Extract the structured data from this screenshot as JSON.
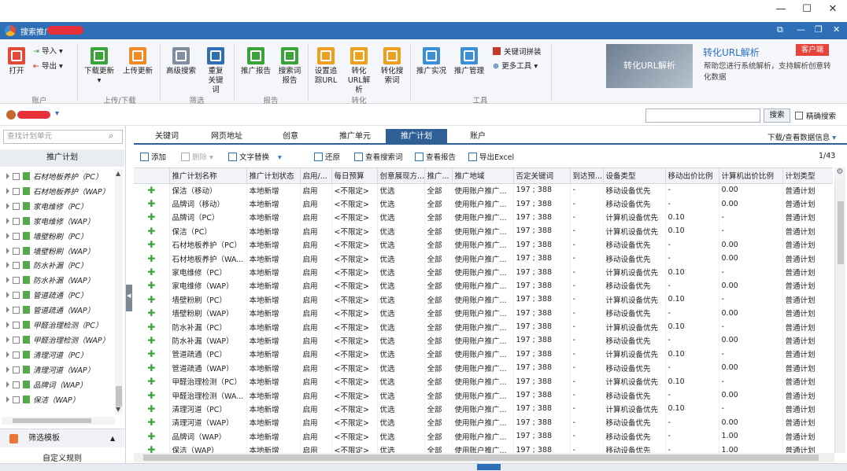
{
  "window": {
    "minimize": "—",
    "maximize": "☐",
    "close": "✕"
  },
  "app": {
    "title": "搜索推广",
    "header_icons": [
      "⧉",
      "—",
      "❐",
      "✕"
    ]
  },
  "ribbon": {
    "buttons": [
      {
        "id": "open",
        "label": "打开",
        "color": "#e04a3a"
      },
      {
        "id": "import",
        "label": "导入",
        "color": "#3a9a3a"
      },
      {
        "id": "export",
        "label": "导出",
        "color": "#c03a2a"
      },
      {
        "id": "download",
        "label": "下载更新",
        "color": "#3aa33a"
      },
      {
        "id": "upload",
        "label": "上传更新",
        "color": "#f08b2a"
      },
      {
        "id": "adv_search",
        "label": "高级搜索",
        "color": "#7f8f9f"
      },
      {
        "id": "dup_kw",
        "label": "重复关键词",
        "color": "#2f6fb5"
      },
      {
        "id": "promo_report",
        "label": "推广报告",
        "color": "#3aa33a"
      },
      {
        "id": "search_report",
        "label": "搜索词报告",
        "color": "#3aa33a"
      },
      {
        "id": "track_url",
        "label": "设置追踪URL",
        "color": "#f0a020"
      },
      {
        "id": "convert_url",
        "label": "转化URL解析",
        "color": "#f0a020"
      },
      {
        "id": "convert_search",
        "label": "转化搜索词",
        "color": "#f0a020"
      },
      {
        "id": "promo_live",
        "label": "推广实况",
        "color": "#3a8fd8"
      },
      {
        "id": "promo_manage",
        "label": "推广管理",
        "color": "#3a8fd8"
      },
      {
        "id": "kw_combo",
        "label": "关键词拼装",
        "color": "#c03a2a"
      },
      {
        "id": "more_tools",
        "label": "更多工具",
        "color": "#2f6fb5"
      }
    ],
    "groups": [
      "账户",
      "上传/下载",
      "筛选",
      "报告",
      "转化",
      "工具"
    ],
    "ad": {
      "banner": "转化URL解析",
      "title": "转化URL解析",
      "desc": "帮助您进行系统解析，支持解析创意转化数据",
      "service": "客户端"
    }
  },
  "search": {
    "button": "搜索",
    "exact": "精确搜索"
  },
  "sidebar": {
    "filter_placeholder": "查找计划单元",
    "header": "推广计划",
    "items": [
      "石材地板养护（PC）",
      "石材地板养护（WAP）",
      "家电维修（PC）",
      "家电维修（WAP）",
      "墙壁粉刷（PC）",
      "墙壁粉刷（WAP）",
      "防水补漏（PC）",
      "防水补漏（WAP）",
      "管道疏通（PC）",
      "管道疏通（WAP）",
      "甲醛治理检测（PC）",
      "甲醛治理检测（WAP）",
      "清理河道（PC）",
      "清理河道（WAP）",
      "品牌词（WAP）",
      "保洁（WAP）"
    ],
    "filter_template": "筛选模板",
    "custom_rule": "自定义规则"
  },
  "tabs": [
    "关键词",
    "网页地址",
    "创意",
    "推广单元",
    "推广计划",
    "账户"
  ],
  "active_tab": 4,
  "download_data": "下载/查看数据信息",
  "toolbar": {
    "add": "添加",
    "delete": "删除",
    "replace": "文字替换",
    "restore": "还原",
    "view_search": "查看搜索词",
    "view_report": "查看报告",
    "export_excel": "导出Excel",
    "pager": "1/43"
  },
  "table": {
    "headers": [
      "",
      "推广计划名称",
      "推广计划状态",
      "启用/...",
      "每日预算",
      "创意展现方...",
      "推广...",
      "推广地域",
      "否定关键词",
      "到达预...",
      "设备类型",
      "移动出价比例",
      "计算机出价比例",
      "计划类型"
    ],
    "rows": [
      [
        "✚",
        "保洁（移动）",
        "本地新增",
        "启用",
        "<不限定>",
        "优选",
        "全部",
        "使用账户推广...",
        "197 ; 388",
        "-",
        "移动设备优先",
        "-",
        "0.00",
        "普通计划"
      ],
      [
        "✚",
        "品牌词（移动）",
        "本地新增",
        "启用",
        "<不限定>",
        "优选",
        "全部",
        "使用账户推广...",
        "197 ; 388",
        "-",
        "移动设备优先",
        "-",
        "0.00",
        "普通计划"
      ],
      [
        "✚",
        "品牌词（PC）",
        "本地新增",
        "启用",
        "<不限定>",
        "优选",
        "全部",
        "使用账户推广...",
        "197 ; 388",
        "-",
        "计算机设备优先",
        "0.10",
        "-",
        "普通计划"
      ],
      [
        "✚",
        "保洁（PC）",
        "本地新增",
        "启用",
        "<不限定>",
        "优选",
        "全部",
        "使用账户推广...",
        "197 ; 388",
        "-",
        "计算机设备优先",
        "0.10",
        "-",
        "普通计划"
      ],
      [
        "✚",
        "石材地板养护（PC）",
        "本地新增",
        "启用",
        "<不限定>",
        "优选",
        "全部",
        "使用账户推广...",
        "197 ; 388",
        "-",
        "移动设备优先",
        "-",
        "0.00",
        "普通计划"
      ],
      [
        "✚",
        "石材地板养护（WA...",
        "本地新增",
        "启用",
        "<不限定>",
        "优选",
        "全部",
        "使用账户推广...",
        "197 ; 388",
        "-",
        "移动设备优先",
        "-",
        "0.00",
        "普通计划"
      ],
      [
        "✚",
        "家电维修（PC）",
        "本地新增",
        "启用",
        "<不限定>",
        "优选",
        "全部",
        "使用账户推广...",
        "197 ; 388",
        "-",
        "计算机设备优先",
        "0.10",
        "-",
        "普通计划"
      ],
      [
        "✚",
        "家电维修（WAP）",
        "本地新增",
        "启用",
        "<不限定>",
        "优选",
        "全部",
        "使用账户推广...",
        "197 ; 388",
        "-",
        "移动设备优先",
        "-",
        "0.00",
        "普通计划"
      ],
      [
        "✚",
        "墙壁粉刷（PC）",
        "本地新增",
        "启用",
        "<不限定>",
        "优选",
        "全部",
        "使用账户推广...",
        "197 ; 388",
        "-",
        "计算机设备优先",
        "0.10",
        "-",
        "普通计划"
      ],
      [
        "✚",
        "墙壁粉刷（WAP）",
        "本地新增",
        "启用",
        "<不限定>",
        "优选",
        "全部",
        "使用账户推广...",
        "197 ; 388",
        "-",
        "移动设备优先",
        "-",
        "0.00",
        "普通计划"
      ],
      [
        "✚",
        "防水补漏（PC）",
        "本地新增",
        "启用",
        "<不限定>",
        "优选",
        "全部",
        "使用账户推广...",
        "197 ; 388",
        "-",
        "计算机设备优先",
        "0.10",
        "-",
        "普通计划"
      ],
      [
        "✚",
        "防水补漏（WAP）",
        "本地新增",
        "启用",
        "<不限定>",
        "优选",
        "全部",
        "使用账户推广...",
        "197 ; 388",
        "-",
        "移动设备优先",
        "-",
        "0.00",
        "普通计划"
      ],
      [
        "✚",
        "管道疏通（PC）",
        "本地新增",
        "启用",
        "<不限定>",
        "优选",
        "全部",
        "使用账户推广...",
        "197 ; 388",
        "-",
        "计算机设备优先",
        "0.10",
        "-",
        "普通计划"
      ],
      [
        "✚",
        "管道疏通（WAP）",
        "本地新增",
        "启用",
        "<不限定>",
        "优选",
        "全部",
        "使用账户推广...",
        "197 ; 388",
        "-",
        "移动设备优先",
        "-",
        "0.00",
        "普通计划"
      ],
      [
        "✚",
        "甲醛治理检测（PC）",
        "本地新增",
        "启用",
        "<不限定>",
        "优选",
        "全部",
        "使用账户推广...",
        "197 ; 388",
        "-",
        "计算机设备优先",
        "0.10",
        "-",
        "普通计划"
      ],
      [
        "✚",
        "甲醛治理检测（WA...",
        "本地新增",
        "启用",
        "<不限定>",
        "优选",
        "全部",
        "使用账户推广...",
        "197 ; 388",
        "-",
        "移动设备优先",
        "-",
        "0.00",
        "普通计划"
      ],
      [
        "✚",
        "清理河道（PC）",
        "本地新增",
        "启用",
        "<不限定>",
        "优选",
        "全部",
        "使用账户推广...",
        "197 ; 388",
        "-",
        "计算机设备优先",
        "0.10",
        "-",
        "普通计划"
      ],
      [
        "✚",
        "清理河道（WAP）",
        "本地新增",
        "启用",
        "<不限定>",
        "优选",
        "全部",
        "使用账户推广...",
        "197 ; 388",
        "-",
        "移动设备优先",
        "-",
        "0.00",
        "普通计划"
      ],
      [
        "✚",
        "品牌词（WAP）",
        "本地新增",
        "启用",
        "<不限定>",
        "优选",
        "全部",
        "使用账户推广...",
        "197 ; 388",
        "-",
        "移动设备优先",
        "-",
        "1.00",
        "普通计划"
      ],
      [
        "✚",
        "保洁（WAP）",
        "本地新增",
        "启用",
        "<不限定>",
        "优选",
        "全部",
        "使用账户推广...",
        "197 ; 388",
        "-",
        "移动设备优先",
        "-",
        "1.00",
        "普通计划"
      ]
    ]
  }
}
